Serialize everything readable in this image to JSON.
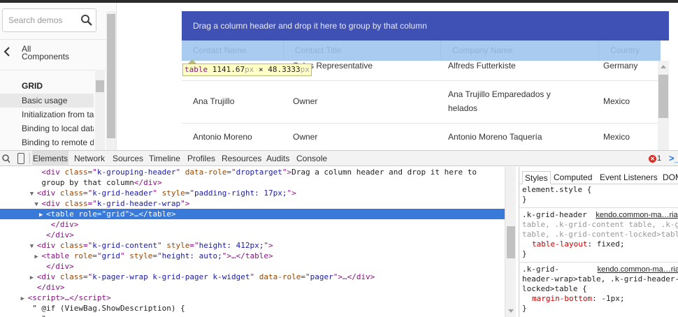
{
  "sidebar": {
    "search_placeholder": "Search demos",
    "back_label_line1": "All",
    "back_label_line2": "Components",
    "section_heading": "GRID",
    "items": [
      {
        "label": "Basic usage",
        "active": true
      },
      {
        "label": "Initialization from table",
        "active": false
      },
      {
        "label": "Binding to local data",
        "active": false
      },
      {
        "label": "Binding to remote data",
        "active": false
      }
    ]
  },
  "grid": {
    "grouping_hint": "Drag a column header and drop it here to group by that column",
    "columns": [
      "Contact Name",
      "Contact Title",
      "Company Name",
      "Country"
    ],
    "rows": [
      {
        "contact_name": "",
        "contact_title": "Sales Representative",
        "company_line1": "Alfreds Futterkiste",
        "company_line2": "",
        "country": "Germany"
      },
      {
        "contact_name": "Ana Trujillo",
        "contact_title": "Owner",
        "company_line1": "Ana Trujillo Emparedados y",
        "company_line2": "helados",
        "country": "Mexico"
      },
      {
        "contact_name": "Antonio Moreno",
        "contact_title": "Owner",
        "company_line1": "Antonio Moreno Taquería",
        "company_line2": "",
        "country": "Mexico"
      }
    ],
    "colors": {
      "grouping_bg": "#3f51b5",
      "header_bg": "#a9cbf0"
    }
  },
  "tooltip": {
    "tag": "table",
    "width_value": "1141.67",
    "unit": "px",
    "times": "×",
    "height_value": "48.3333"
  },
  "devtools": {
    "tabs": [
      "Elements",
      "Network",
      "Sources",
      "Timeline",
      "Profiles",
      "Resources",
      "Audits",
      "Console"
    ],
    "active_tab": "Elements",
    "error_count": "1",
    "dom_lines": [
      {
        "indent": 9,
        "tri": "",
        "html": "&lt;div <an>class</an>=\"<av>k-grouping-header</av>\" <an>data-role</an>=\"<av>droptarget</av>\"&gt;<tx>Drag a column header and drop it here to</tx>"
      },
      {
        "indent": 9,
        "tri": "",
        "html": "<tx>group by that column</tx>&lt;/div&gt;"
      },
      {
        "indent": 8,
        "tri": "▼",
        "html": "&lt;div <an>class</an>=\"<av>k-grid-header</av>\" <an>style</an>=\"<av>padding-right: 17px;</av>\"&gt;"
      },
      {
        "indent": 9,
        "tri": "▼",
        "html": "&lt;div <an>class</an>=\"<av>k-grid-header-wrap</av>\"&gt;"
      },
      {
        "indent": 10,
        "tri": "▶",
        "html": "&lt;table <an>role</an>=\"<av>grid</av>\"&gt;…&lt;/table&gt;",
        "selected": true
      },
      {
        "indent": 11,
        "tri": "",
        "html": "&lt;/div&gt;"
      },
      {
        "indent": 10,
        "tri": "",
        "html": "&lt;/div&gt;"
      },
      {
        "indent": 8,
        "tri": "▼",
        "html": "&lt;div <an>class</an>=\"<av>k-grid-content</av>\" <an>style</an>=\"<av>height: 412px;</av>\"&gt;"
      },
      {
        "indent": 9,
        "tri": "▶",
        "html": "&lt;table <an>role</an>=\"<av>grid</av>\" <an>style</an>=\"<av>height: auto;</av>\"&gt;…&lt;/table&gt;"
      },
      {
        "indent": 10,
        "tri": "",
        "html": "&lt;/div&gt;"
      },
      {
        "indent": 8,
        "tri": "▶",
        "html": "&lt;div <an>class</an>=\"<av>k-pager-wrap k-grid-pager k-widget</av>\" <an>data-role</an>=\"<av>pager</av>\"&gt;…&lt;/div&gt;"
      },
      {
        "indent": 8,
        "tri": "",
        "html": "&lt;/div&gt;"
      },
      {
        "indent": 6,
        "tri": "▶",
        "html": "&lt;script&gt;…&lt;/script&gt;"
      },
      {
        "indent": 7,
        "tri": "",
        "html": "<tx>\" @if (ViewBag.ShowDescription) {</tx>"
      },
      {
        "indent": 9,
        "tri": "",
        "html": "<tx>\"</tx>"
      }
    ],
    "style_tabs": [
      "Styles",
      "Computed",
      "Event Listeners",
      "DOM"
    ],
    "styles": {
      "element_style": "element.style {",
      "close": "}",
      "rule1_selector_a": ".k-grid-header",
      "rule1_source": "kendo.common-ma…ria",
      "rule1_selector_b": "table, .k-grid-content table, .k-gr",
      "rule1_selector_c": "table, .k-grid-content-locked>table {",
      "rule1_prop": "table-layout",
      "rule1_val": "fixed;",
      "rule2_selector_a": ".k-grid-",
      "rule2_source": "kendo.common-ma…ria",
      "rule2_selector_b": "header-wrap>table, .k-grid-header-",
      "rule2_selector_c": "locked>table {",
      "rule2_prop": "margin-bottom",
      "rule2_val": "-1px;"
    }
  }
}
